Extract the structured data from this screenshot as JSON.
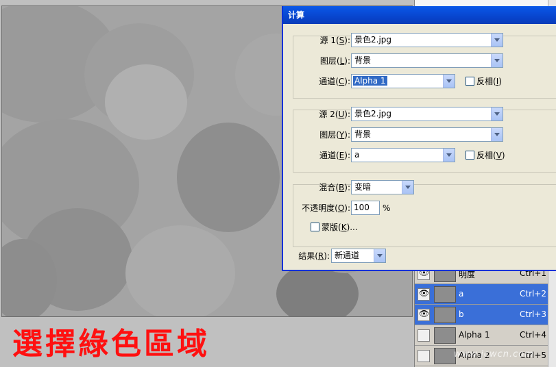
{
  "caption": "選擇綠色區域",
  "watermark": "www.jcwcn.com",
  "dialog": {
    "title": "计算",
    "source1": {
      "label_pre": "源 1(",
      "label_key": "S",
      "label_post": "):",
      "value": "景色2.jpg",
      "layer_pre": "图层(",
      "layer_key": "L",
      "layer_post": "):",
      "layer_value": "背景",
      "channel_pre": "通道(",
      "channel_key": "C",
      "channel_post": "):",
      "channel_value": "Alpha 1",
      "invert_pre": "反相(",
      "invert_key": "I",
      "invert_post": ")"
    },
    "source2": {
      "label_pre": "源 2(",
      "label_key": "U",
      "label_post": "):",
      "value": "景色2.jpg",
      "layer_pre": "图层(",
      "layer_key": "Y",
      "layer_post": "):",
      "layer_value": "背景",
      "channel_pre": "通道(",
      "channel_key": "E",
      "channel_post": "):",
      "channel_value": "a",
      "invert_pre": "反相(",
      "invert_key": "V",
      "invert_post": ")"
    },
    "blend": {
      "label_pre": "混合(",
      "label_key": "B",
      "label_post": "):",
      "value": "变暗",
      "opacity_pre": "不透明度(",
      "opacity_key": "O",
      "opacity_post": "):",
      "opacity_value": "100",
      "opacity_unit": "%",
      "mask_pre": "蒙版(",
      "mask_key": "K",
      "mask_post": ")..."
    },
    "result": {
      "label_pre": "结果(",
      "label_key": "R",
      "label_post": "):",
      "value": "新通道"
    }
  },
  "channels": [
    {
      "name": "明度",
      "shortcut": "Ctrl+1",
      "visible": true,
      "selected": false
    },
    {
      "name": "a",
      "shortcut": "Ctrl+2",
      "visible": true,
      "selected": true
    },
    {
      "name": "b",
      "shortcut": "Ctrl+3",
      "visible": true,
      "selected": true
    },
    {
      "name": "Alpha 1",
      "shortcut": "Ctrl+4",
      "visible": false,
      "selected": false
    },
    {
      "name": "Alpha 2",
      "shortcut": "Ctrl+5",
      "visible": false,
      "selected": false
    }
  ],
  "colors": {
    "accent": "#0842c9",
    "selection": "#316ac5",
    "caption": "#ff1010"
  }
}
